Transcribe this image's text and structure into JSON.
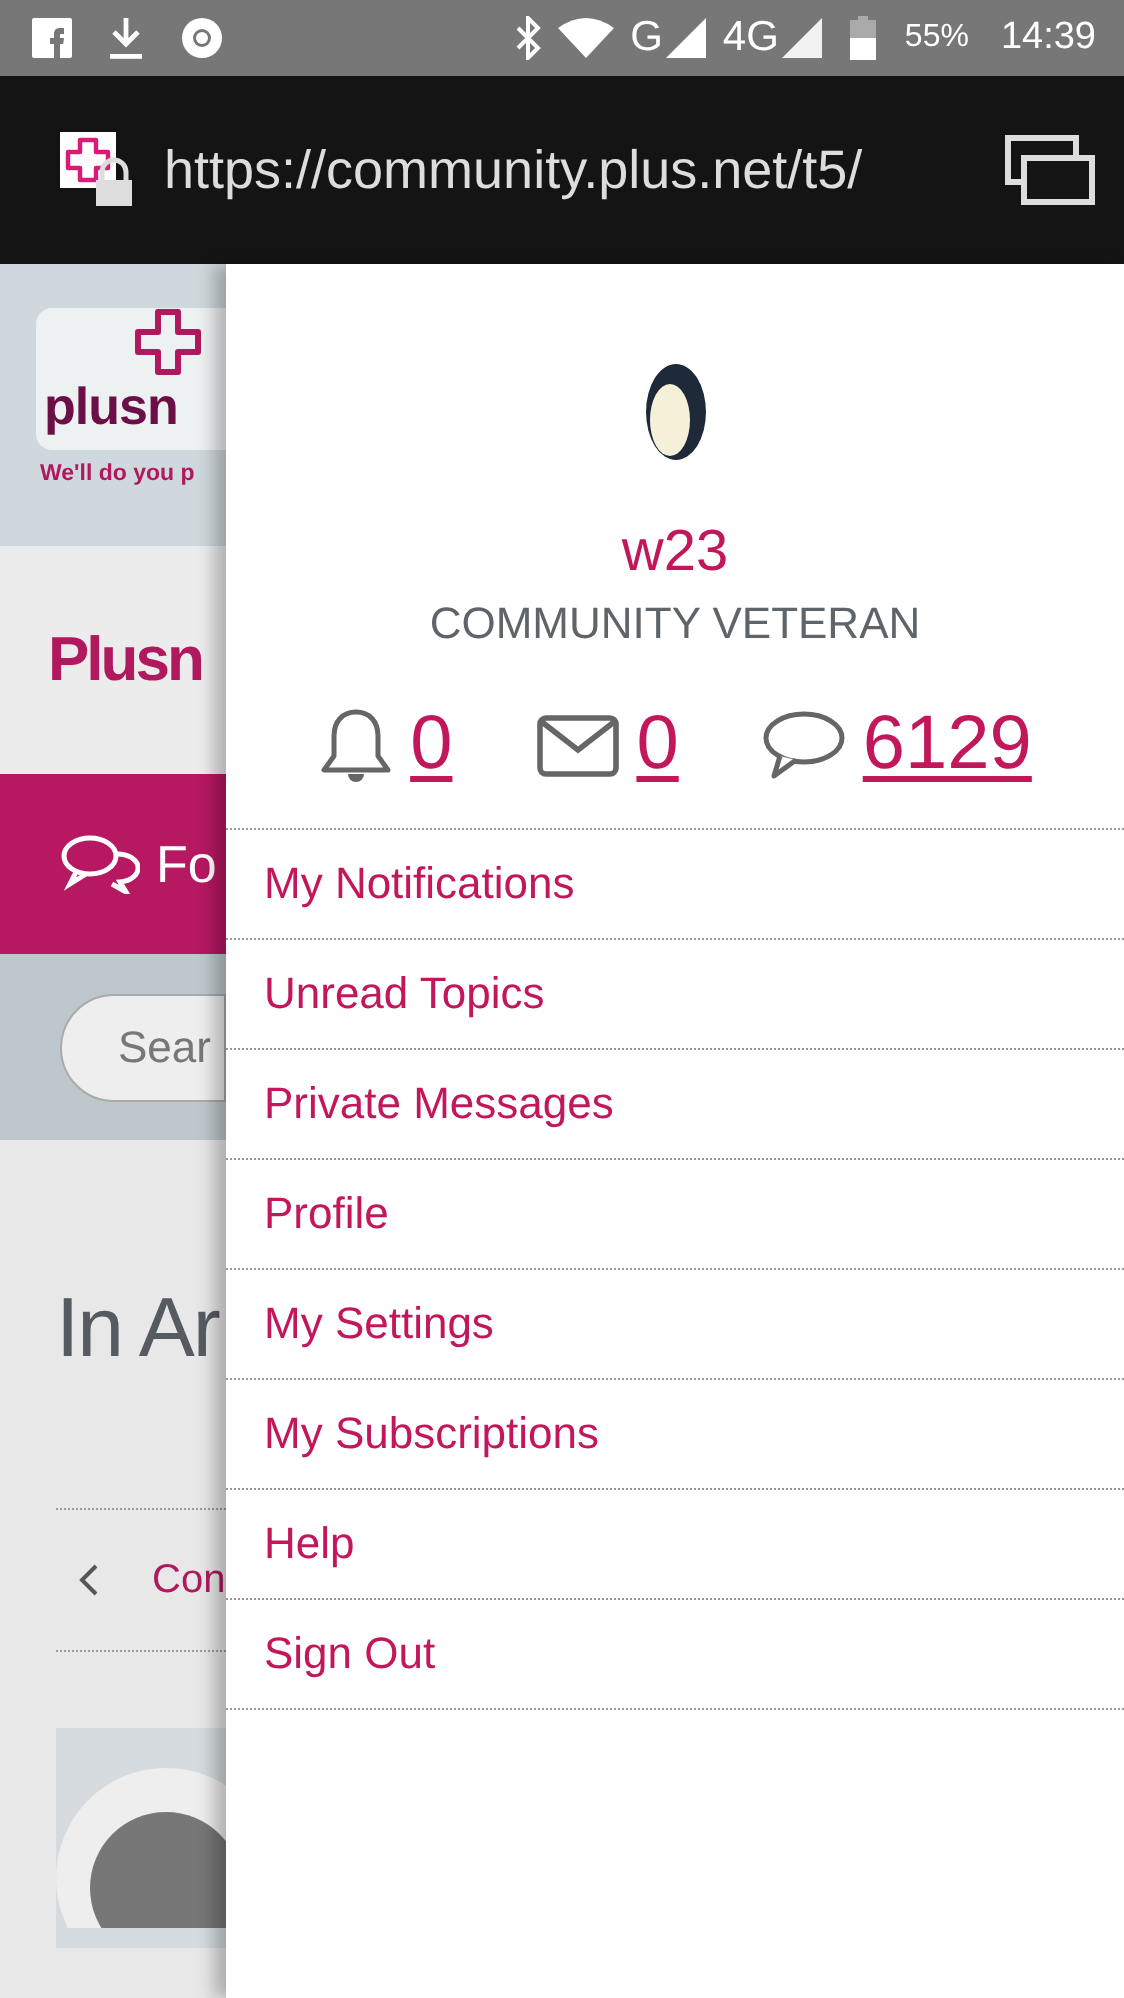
{
  "status_bar": {
    "network_labels": [
      "G",
      "4G"
    ],
    "battery": "55%",
    "time": "14:39"
  },
  "address_bar": {
    "url": "https://community.plus.net/t5/"
  },
  "background_page": {
    "logo_text": "plusn",
    "tagline": "We'll do you p",
    "heading": "Plusn",
    "nav_label": "Fo",
    "search_placeholder": "Sear",
    "page_title": "In Ar",
    "breadcrumb": "Con"
  },
  "drawer": {
    "user": {
      "name": "w23",
      "rank": "COMMUNITY VETERAN"
    },
    "stats": [
      {
        "kind": "notifications",
        "count": "0"
      },
      {
        "kind": "messages",
        "count": "0"
      },
      {
        "kind": "posts",
        "count": "6129"
      }
    ],
    "menu": [
      "My Notifications",
      "Unread Topics",
      "Private Messages",
      "Profile",
      "My Settings",
      "My Subscriptions",
      "Help",
      "Sign Out"
    ]
  }
}
